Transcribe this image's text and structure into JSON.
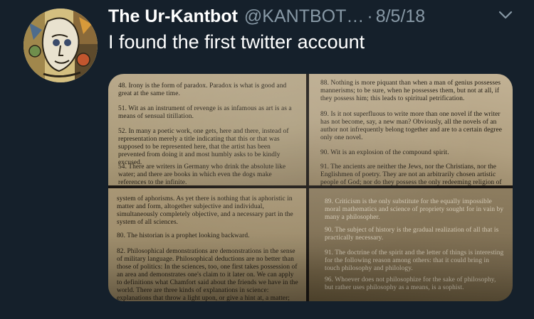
{
  "tweet": {
    "display_name": "The Ur-Kantbot",
    "handle": "@KANTBOT…",
    "separator": "·",
    "date": "8/5/18",
    "text": "I found the first twitter account",
    "menu_icon": "chevron-down-icon",
    "avatar_icon": "avatar-illustration"
  },
  "media": {
    "top_left": [
      "48. Irony is the form of paradox. Paradox is what is good and great at the same time.",
      "51. Wit as an instrument of revenge is as infamous as art is as a means of sensual titillation.",
      "52. In many a poetic work, one gets, here and there, instead of representation merely a title indicating that this or that was supposed to be represented here, that the artist has been prevented from doing it and most humbly asks to be kindly excused.",
      "54. There are writers in Germany who drink the absolute like water; and there are books in which even the dogs make references to the infinite."
    ],
    "top_right": [
      "88. Nothing is more piquant than when a man of genius possesses mannerisms; to be sure, when he possesses them, but not at all, if they possess him; this leads to spiritual petrification.",
      "89. Is it not superfluous to write more than one novel if the writer has not become, say, a new man? Obviously, all the novels of an author not infrequently belong together and are to a certain degree only one novel.",
      "90. Wit is an explosion of the compound spirit.",
      "91. The ancients are neither the Jews, nor the Christians, nor the Englishmen of poetry. They are not an arbitrarily chosen artistic people of God; nor do they possess the only redeeming religion of"
    ],
    "bottom_left": [
      "system of aphorisms. As yet there is nothing that is aphoristic in matter and form, altogether subjective and individual, simultaneously completely objective, and a necessary part in the system of all sciences.",
      "80. The historian is a prophet looking backward.",
      "82. Philosophical demonstrations are demonstrations in the sense of military language. Philosophical deductions are no better than those of politics: In the sciences, too, one first takes possession of an area and demonstrates one's claim to it later on. We can apply to definitions what Chamfort said about the friends we have in the world. There are three kinds of explanations in science: explanations that throw a light upon, or give a hint at, a matter; explanations"
    ],
    "bottom_right": [
      "89. Criticism is the only substitute for the equally impossible moral mathematics and science of propriety sought for in vain by many a philosopher.",
      "90. The subject of history is the gradual realization of all that is practically necessary.",
      "91. The doctrine of the spirit and the letter of things is interesting for the following reason among others: that it could bring in touch philosophy and philology.",
      "96. Whoever does not philosophize for the sake of philosophy, but rather uses philosophy as a means, is a sophist."
    ]
  }
}
